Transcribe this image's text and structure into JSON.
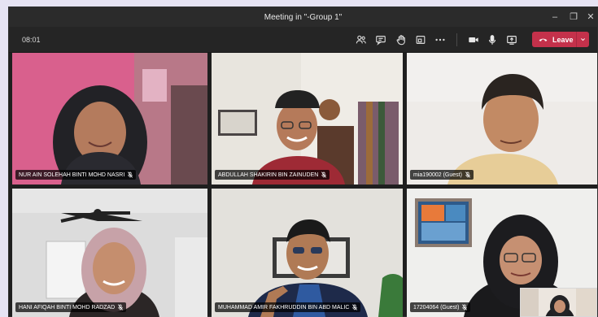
{
  "window": {
    "title": "Meeting in \"-Group 1\""
  },
  "window_controls": {
    "minimize": "–",
    "maximize": "❐",
    "close": "✕"
  },
  "toolbar": {
    "timer": "08:01",
    "icons": [
      "people-icon",
      "chat-icon",
      "raise-hand-icon",
      "rooms-icon",
      "more-icon",
      "camera-icon",
      "microphone-icon",
      "share-screen-icon"
    ],
    "leave_label": "Leave",
    "leave_color": "#c4314b"
  },
  "participants": [
    {
      "name": "NUR AIN SOLEHAH BINTI MOHD NASRI",
      "muted": true
    },
    {
      "name": "ABDULLAH SHAKIRIN BIN ZAINUDEN",
      "muted": true
    },
    {
      "name": "mia190002 (Guest)",
      "muted": true
    },
    {
      "name": "HANI AFIQAH BINTI MOHD RADZAD",
      "muted": true
    },
    {
      "name": "MUHAMMAD AMIR FAKHRUDDIN BIN ABD MALIC",
      "muted": true
    },
    {
      "name": "17204064 (Guest)",
      "muted": true
    }
  ]
}
